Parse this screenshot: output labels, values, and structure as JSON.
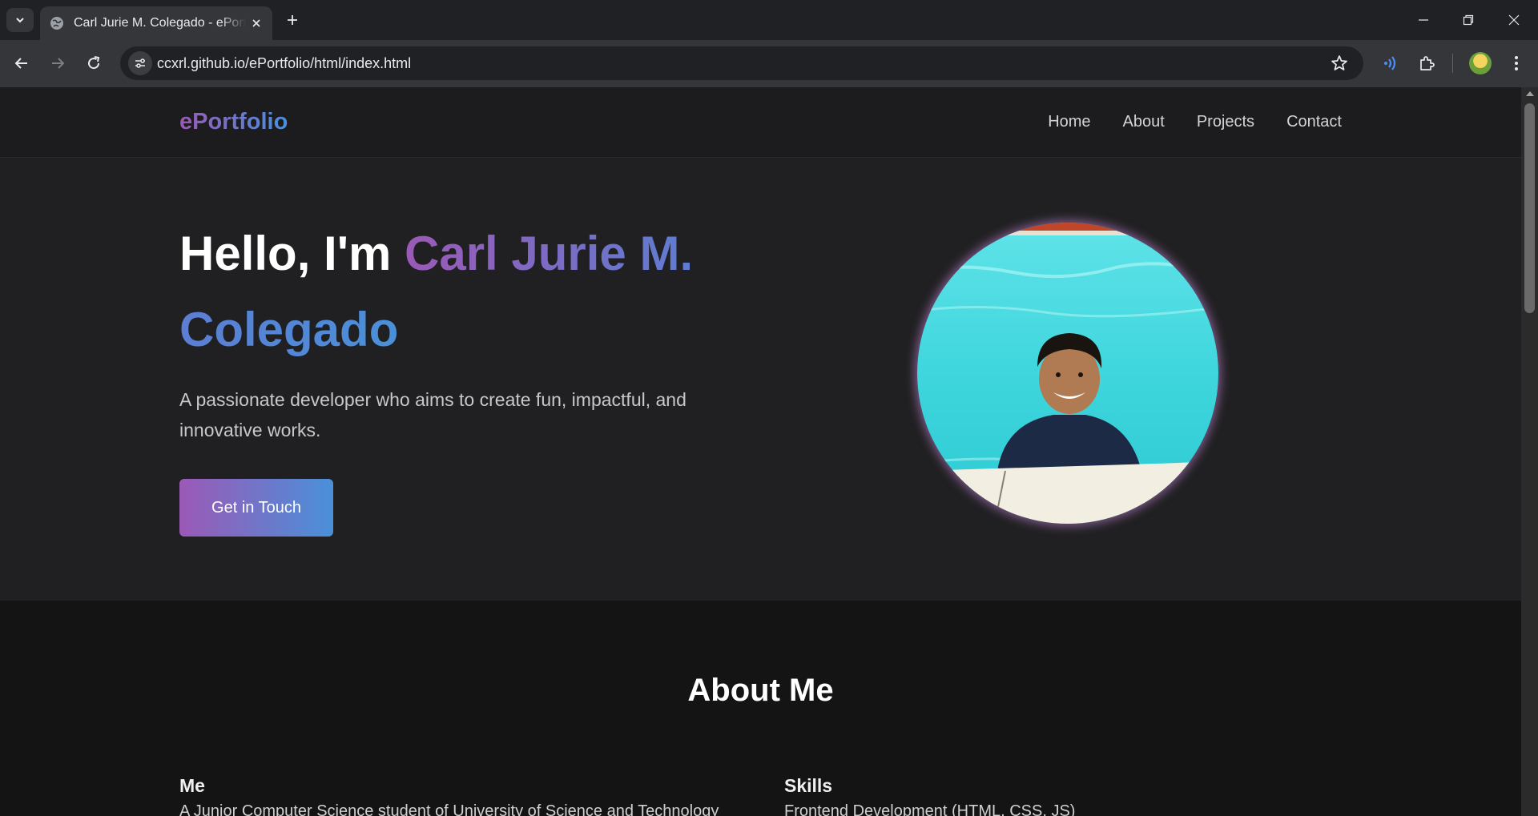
{
  "browser": {
    "tab_title": "Carl Jurie M. Colegado - ePortfolio",
    "url": "ccxrl.github.io/ePortfolio/html/index.html"
  },
  "site": {
    "logo": "ePortfolio",
    "nav": [
      "Home",
      "About",
      "Projects",
      "Contact"
    ]
  },
  "hero": {
    "greeting": "Hello, I'm ",
    "name": "Carl Jurie M. Colegado",
    "subtitle": "A passionate developer who aims to create fun, impactful, and innovative works.",
    "cta_label": "Get in Touch"
  },
  "about": {
    "title": "About Me",
    "me_heading": "Me",
    "me_text": "A Junior Computer Science student of University of Science and Technology",
    "skills_heading": "Skills",
    "skills_text": "Frontend Development (HTML, CSS, JS)"
  },
  "colors": {
    "accent_purple": "#9b59b6",
    "accent_blue": "#4a90d9",
    "page_bg": "#141414",
    "hero_bg": "#202022"
  },
  "icons": [
    "tab-search-icon",
    "globe-icon",
    "close-icon",
    "plus-icon",
    "minimize-icon",
    "restore-icon",
    "back-icon",
    "forward-icon",
    "reload-icon",
    "site-info-icon",
    "star-icon",
    "broadcast-icon",
    "extensions-icon",
    "more-icon"
  ]
}
